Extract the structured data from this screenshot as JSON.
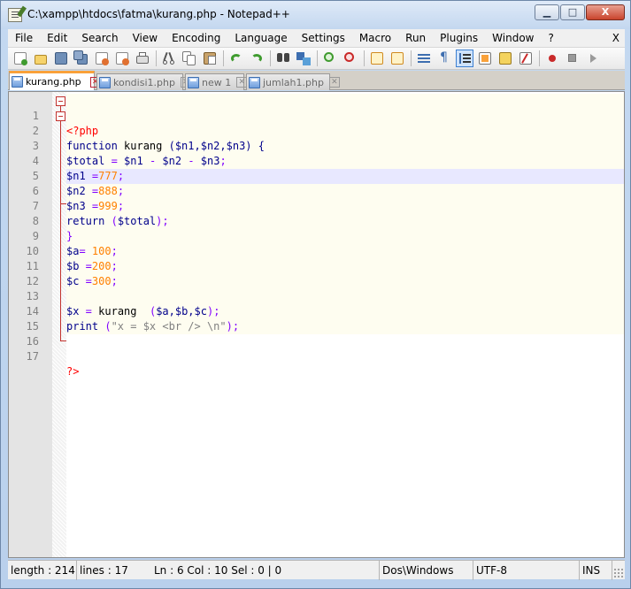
{
  "window": {
    "title": "C:\\xampp\\htdocs\\fatma\\kurang.php - Notepad++",
    "controls": {
      "minimize": "▁",
      "maximize": "□",
      "close": "X"
    }
  },
  "menu": {
    "items": [
      "File",
      "Edit",
      "Search",
      "View",
      "Encoding",
      "Language",
      "Settings",
      "Macro",
      "Run",
      "Plugins",
      "Window",
      "?"
    ],
    "close_label": "X"
  },
  "toolbar": {
    "icons": [
      "new-file-icon",
      "open-file-icon",
      "save-icon",
      "save-all-icon",
      "close-icon",
      "close-all-icon",
      "print-icon",
      "cut-icon",
      "copy-icon",
      "paste-icon",
      "undo-icon",
      "redo-icon",
      "find-icon",
      "replace-icon",
      "zoom-in-icon",
      "zoom-out-icon",
      "sync-vertical-icon",
      "sync-horizontal-icon",
      "word-wrap-icon",
      "show-all-chars-icon",
      "indent-guide-icon",
      "user-lang-icon",
      "doc-map-icon",
      "record-macro-icon",
      "stop-macro-icon",
      "play-macro-icon"
    ],
    "colors": {
      "green": "#3f9b2f",
      "blue": "#3d6eb0",
      "red": "#c92a2a",
      "orange": "#f9a13a"
    }
  },
  "tabs": [
    {
      "label": "kurang.php",
      "active": true
    },
    {
      "label": "kondisi1.php",
      "active": false
    },
    {
      "label": "new 1",
      "active": false
    },
    {
      "label": "jumlah1.php",
      "active": false
    }
  ],
  "editor": {
    "lines": [
      {
        "n": "1"
      },
      {
        "n": "2"
      },
      {
        "n": "3"
      },
      {
        "n": "4"
      },
      {
        "n": "5"
      },
      {
        "n": "6"
      },
      {
        "n": "7"
      },
      {
        "n": "8"
      },
      {
        "n": "9"
      },
      {
        "n": "10"
      },
      {
        "n": "11"
      },
      {
        "n": "12"
      },
      {
        "n": "13"
      },
      {
        "n": "14"
      },
      {
        "n": "15"
      },
      {
        "n": "16"
      },
      {
        "n": "17"
      }
    ],
    "code": {
      "l1": "<?php",
      "l2_kw": "function",
      "l2_rest": " kurang ",
      "l2_args": "($n1,$n2,$n3) {",
      "l3_a": "$total",
      "l3_b": " = ",
      "l3_c": "$n1",
      "l3_d": " - ",
      "l3_e": "$n2",
      "l3_f": " - ",
      "l3_g": "$n3",
      "l3_h": ";",
      "l4_v": "$n1",
      "l4_o": " =",
      "l4_n": "777",
      "l4_s": ";",
      "l5_v": "$n2",
      "l5_o": " =",
      "l5_n": "888",
      "l5_s": ";",
      "l6_v": "$n3",
      "l6_o": " =",
      "l6_n": "999",
      "l6_s": ";",
      "l7_kw": "return",
      "l7_a": " (",
      "l7_v": "$total",
      "l7_b": ");",
      "l8": "}",
      "l9_v": "$a",
      "l9_o": "= ",
      "l9_n": "100",
      "l9_s": ";",
      "l10_v": "$b",
      "l10_o": " =",
      "l10_n": "200",
      "l10_s": ";",
      "l11_v": "$c",
      "l11_o": " =",
      "l11_n": "300",
      "l11_s": ";",
      "l13_v": "$x",
      "l13_o": " = ",
      "l13_f": "kurang",
      "l13_a": "  (",
      "l13_args": "$a,$b,$c",
      "l13_b": ");",
      "l14_kw": "print",
      "l14_a": " (",
      "l14_s": "\"x = $x <br /> \\n\"",
      "l14_b": ");",
      "l17": "?>"
    },
    "colors": {
      "keyword": "#00008b",
      "number": "#ff8000",
      "tag": "#ff0000",
      "operator": "#8000ff",
      "current_line": "#e8e8ff"
    }
  },
  "status": {
    "length": "length : 214",
    "lines": "lines : 17",
    "position": "Ln : 6    Col : 10    Sel : 0 | 0",
    "eol": "Dos\\Windows",
    "encoding": "UTF-8",
    "mode": "INS"
  }
}
